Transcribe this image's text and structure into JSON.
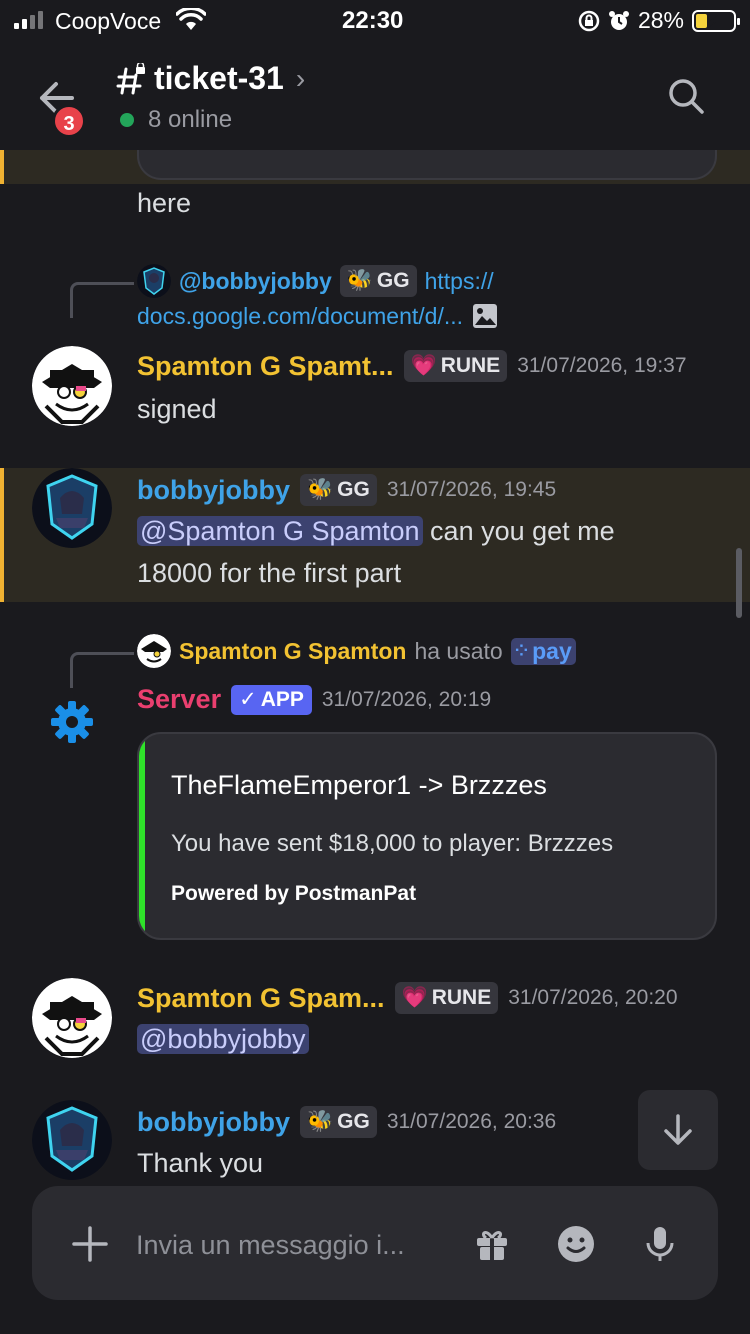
{
  "status_bar": {
    "carrier": "CoopVoce",
    "time": "22:30",
    "battery": "28%",
    "battery_level": 0.28
  },
  "header": {
    "channel_name": "ticket-31",
    "online": "8 online",
    "unread_badge": "3"
  },
  "messages": [
    {
      "text": "here"
    },
    {
      "reply": {
        "author": "@bobbyjobby",
        "tag": "GG",
        "preview": "https://",
        "preview2": "docs.google.com/document/d/..."
      },
      "author": "Spamton G Spamt...",
      "tag": "RUNE",
      "time": "31/07/2026, 19:37",
      "text": "signed"
    },
    {
      "author": "bobbyjobby",
      "tag": "GG",
      "time": "31/07/2026, 19:45",
      "mention": "@Spamton G Spamton",
      "text": " can you get me",
      "text2": "18000 for the first part"
    },
    {
      "reply": {
        "author": "Spamton G Spamton",
        "used": "ha usato",
        "command": "pay"
      },
      "author": "Server",
      "tag": "APP",
      "time": "31/07/2026, 20:19",
      "embed": {
        "title": "TheFlameEmperor1 -> Brzzzes",
        "description": "You have sent $18,000 to player: Brzzzes",
        "footer": "Powered by PostmanPat"
      }
    },
    {
      "author": "Spamton G Spam...",
      "tag": "RUNE",
      "time": "31/07/2026, 20:20",
      "mention": "@bobbyjobby"
    },
    {
      "author": "bobbyjobby",
      "tag": "GG",
      "time": "31/07/2026, 20:36",
      "text": "Thank you"
    }
  ],
  "composer": {
    "placeholder": "Invia un messaggio i..."
  },
  "colors": {
    "background": "#1a1a1e",
    "highlight_bar": "#f0b232",
    "embed_bar": "#2fe22a",
    "brand": "#5865f2"
  }
}
